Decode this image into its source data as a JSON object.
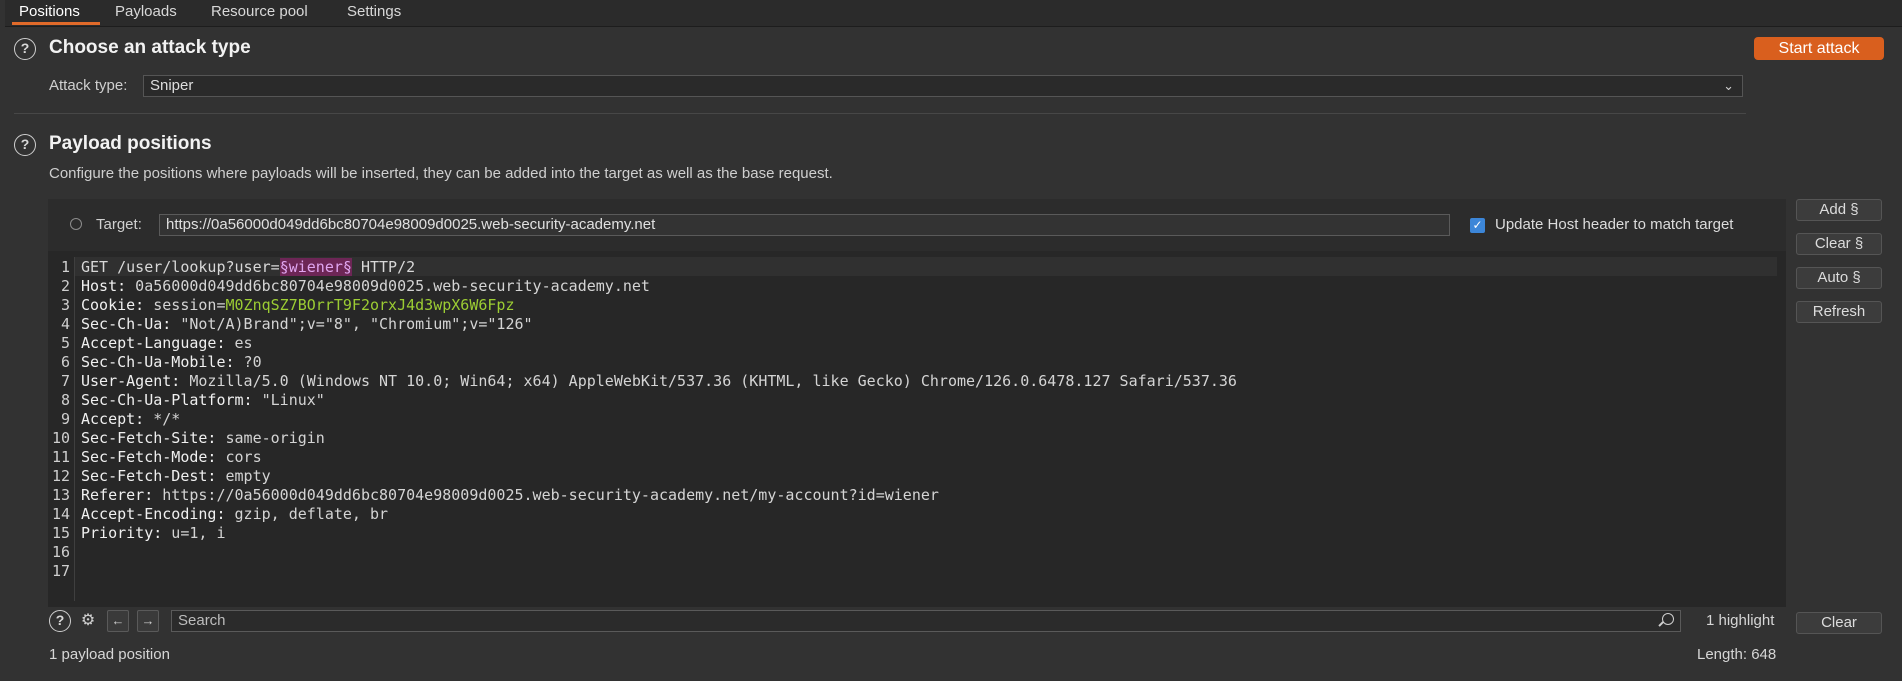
{
  "tabs": [
    {
      "label": "Positions",
      "active": true
    },
    {
      "label": "Payloads",
      "active": false
    },
    {
      "label": "Resource pool",
      "active": false
    },
    {
      "label": "Settings",
      "active": false
    }
  ],
  "attack_type_section": {
    "help_glyph": "?",
    "title": "Choose an attack type",
    "start_button": "Start attack",
    "attack_type_label": "Attack type:",
    "attack_type_value": "Sniper"
  },
  "payload_section": {
    "help_glyph": "?",
    "title": "Payload positions",
    "description": "Configure the positions where payloads will be inserted, they can be added into the target as well as the base request.",
    "target_label": "Target:",
    "target_value": "https://0a56000d049dd6bc80704e98009d0025.web-security-academy.net",
    "update_host_label": "Update Host header to match target",
    "update_host_checked": true
  },
  "side_buttons": {
    "add": "Add §",
    "clear": "Clear §",
    "auto": "Auto §",
    "refresh": "Refresh",
    "clear_bottom": "Clear"
  },
  "request": {
    "line_numbers": [
      "1",
      "2",
      "3",
      "4",
      "5",
      "6",
      "7",
      "8",
      "9",
      "10",
      "11",
      "12",
      "13",
      "14",
      "15",
      "16",
      "17"
    ],
    "line1": {
      "pre": "GET /user/lookup?user=",
      "payload": "§wiener§",
      "post": " HTTP/2"
    },
    "host": {
      "name": "Host:",
      "value": " 0a56000d049dd6bc80704e98009d0025.web-security-academy.net"
    },
    "cookie": {
      "name": "Cookie:",
      "key": " session=",
      "value": "M0ZnqSZ7BOrrT9F2orxJ4d3wpX6W6Fpz"
    },
    "sec_ch_ua": {
      "name": "Sec-Ch-Ua:",
      "value": " \"Not/A)Brand\";v=\"8\", \"Chromium\";v=\"126\""
    },
    "accept_language": {
      "name": "Accept-Language:",
      "value": " es"
    },
    "sec_ch_ua_mobile": {
      "name": "Sec-Ch-Ua-Mobile:",
      "value": " ?0"
    },
    "user_agent": {
      "name": "User-Agent:",
      "value": " Mozilla/5.0 (Windows NT 10.0; Win64; x64) AppleWebKit/537.36 (KHTML, like Gecko) Chrome/126.0.6478.127 Safari/537.36"
    },
    "sec_ch_ua_platform": {
      "name": "Sec-Ch-Ua-Platform:",
      "value": " \"Linux\""
    },
    "accept": {
      "name": "Accept:",
      "value": " */*"
    },
    "sec_fetch_site": {
      "name": "Sec-Fetch-Site:",
      "value": " same-origin"
    },
    "sec_fetch_mode": {
      "name": "Sec-Fetch-Mode:",
      "value": " cors"
    },
    "sec_fetch_dest": {
      "name": "Sec-Fetch-Dest:",
      "value": " empty"
    },
    "referer": {
      "name": "Referer:",
      "value": " https://0a56000d049dd6bc80704e98009d0025.web-security-academy.net/my-account?id=wiener"
    },
    "accept_encoding": {
      "name": "Accept-Encoding:",
      "value": " gzip, deflate, br"
    },
    "priority": {
      "name": "Priority:",
      "value": " u=1, i"
    }
  },
  "search": {
    "placeholder": "Search",
    "highlight_count": "1 highlight",
    "help_glyph": "?"
  },
  "footer": {
    "payload_count": "1 payload position",
    "length": "Length: 648"
  },
  "icons": {
    "help": "help-circle-icon",
    "settings": "gear-icon",
    "back": "arrow-left-icon",
    "forward": "arrow-right-icon",
    "search": "magnifier-icon",
    "target": "crosshair-icon",
    "dropdown": "chevron-down-icon"
  },
  "colors": {
    "accent": "#d95f1e",
    "payload_bg": "#6d2656",
    "cookie_value": "#9ccd33",
    "checkbox": "#3c86d8"
  }
}
